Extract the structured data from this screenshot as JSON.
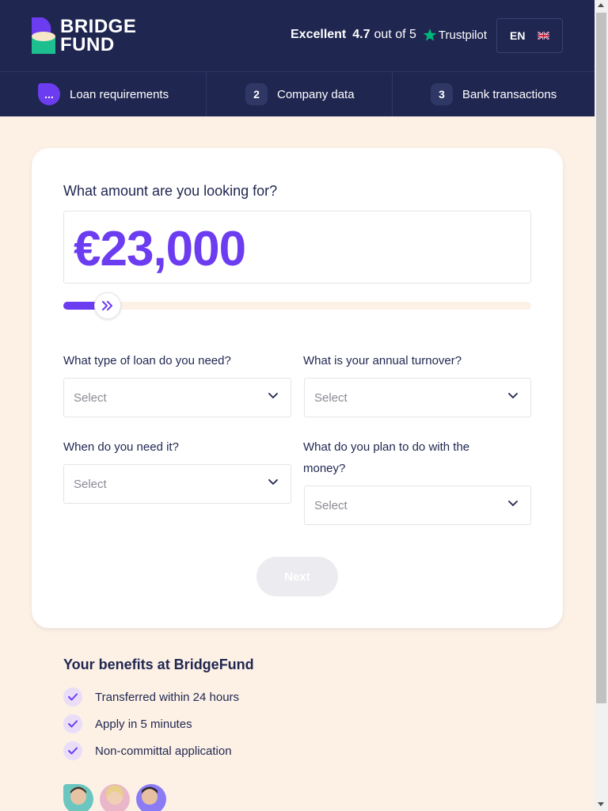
{
  "header": {
    "logo_line1": "BRIDGE",
    "logo_line2": "FUND",
    "rating": {
      "label": "Excellent",
      "score": "4.7",
      "out_of": "out of 5",
      "provider": "Trustpilot"
    },
    "language": "EN"
  },
  "steps": [
    {
      "badge": "...",
      "label": "Loan requirements",
      "active": true
    },
    {
      "badge": "2",
      "label": "Company data",
      "active": false
    },
    {
      "badge": "3",
      "label": "Bank transactions",
      "active": false
    }
  ],
  "form": {
    "amount_question": "What amount are you looking for?",
    "amount_value": "€23,000",
    "slider_fraction": 0.095,
    "fields": [
      {
        "label": "What type of loan do you need?",
        "placeholder": "Select"
      },
      {
        "label": "What is your annual turnover?",
        "placeholder": "Select"
      },
      {
        "label": "When do you need it?",
        "placeholder": "Select"
      },
      {
        "label": "What do you plan to do with the money?",
        "placeholder": "Select"
      }
    ],
    "next_label": "Next"
  },
  "benefits": {
    "title": "Your benefits at BridgeFund",
    "items": [
      "Transferred within 24 hours",
      "Apply in 5 minutes",
      "Non-committal application"
    ]
  },
  "colors": {
    "navy": "#1F2650",
    "purple": "#6C3CF0",
    "cream": "#FDF1E6",
    "teal": "#1DBF91",
    "trustpilot_green": "#00B67A"
  }
}
